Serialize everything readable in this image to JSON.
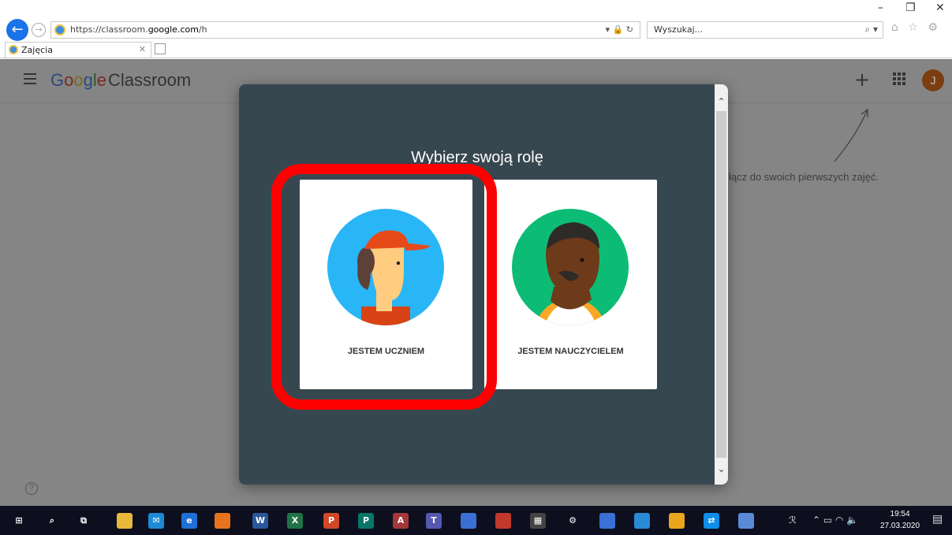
{
  "window": {
    "minimize": "–",
    "restore": "❐",
    "close": "✕"
  },
  "browser": {
    "url_prefix": "https://classroom.",
    "url_domain": "google.com",
    "url_suffix": "/h",
    "url_tools": "▾ 🔒 ↻",
    "search_placeholder": "Wyszukaj...",
    "search_glyph": "⌕ ▾",
    "fav_glyphs": "⌂ ☆ ⚙",
    "tab_title": "Zajęcia",
    "tab_close": "✕"
  },
  "page": {
    "logo_google": [
      "G",
      "o",
      "o",
      "g",
      "l",
      "e"
    ],
    "logo_classroom": "Classroom",
    "plus": "+",
    "avatar_letter": "J",
    "hint_text": "łącz do swoich pierwszych zajęć.",
    "help": "?"
  },
  "dialog": {
    "title": "Wybierz swoją rolę",
    "roles": [
      {
        "label": "JESTEM UCZNIEM"
      },
      {
        "label": "JESTEM NAUCZYCIELEM"
      }
    ],
    "scroll_up": "⌃",
    "scroll_down": "⌄"
  },
  "taskbar": {
    "items": [
      {
        "name": "windows-start-icon",
        "glyph": "⊞",
        "color": "#0d0f1e"
      },
      {
        "name": "search-icon",
        "glyph": "⌕",
        "color": "#0d0f1e"
      },
      {
        "name": "task-view-icon",
        "glyph": "⧉",
        "color": "#0d0f1e"
      },
      {
        "name": "file-explorer-icon",
        "glyph": "",
        "color": "#e8b83a"
      },
      {
        "name": "mail-icon",
        "glyph": "✉",
        "color": "#1e8ad6"
      },
      {
        "name": "internet-explorer-icon",
        "glyph": "e",
        "color": "#1e6fd6"
      },
      {
        "name": "firefox-icon",
        "glyph": "",
        "color": "#e8731e"
      },
      {
        "name": "word-icon",
        "glyph": "W",
        "color": "#2b579a"
      },
      {
        "name": "excel-icon",
        "glyph": "X",
        "color": "#217346"
      },
      {
        "name": "powerpoint-icon",
        "glyph": "P",
        "color": "#d24726"
      },
      {
        "name": "publisher-icon",
        "glyph": "P",
        "color": "#077568"
      },
      {
        "name": "access-icon",
        "glyph": "A",
        "color": "#a4373a"
      },
      {
        "name": "teams-icon",
        "glyph": "T",
        "color": "#5558af"
      },
      {
        "name": "save-disk-icon",
        "glyph": "",
        "color": "#3a6fd6"
      },
      {
        "name": "app-icon",
        "glyph": "",
        "color": "#c0392b"
      },
      {
        "name": "calculator-icon",
        "glyph": "▦",
        "color": "#444"
      },
      {
        "name": "settings-icon",
        "glyph": "⚙",
        "color": "#0d0f1e"
      },
      {
        "name": "network-app-icon",
        "glyph": "",
        "color": "#3a6fd6"
      },
      {
        "name": "app2-icon",
        "glyph": "",
        "color": "#2a8ad6"
      },
      {
        "name": "chrome-icon",
        "glyph": "",
        "color": "#e8a51e"
      },
      {
        "name": "teamviewer-icon",
        "glyph": "⇄",
        "color": "#0e8ee9"
      },
      {
        "name": "app3-icon",
        "glyph": "",
        "color": "#5a8ad6"
      }
    ],
    "tray_people": "ℛ",
    "tray_icons": "⌃  ▭  ◠  🔈",
    "time": "19:54",
    "date": "27.03.2020",
    "notify": "▤"
  },
  "colors": {
    "highlight": "#ff0000",
    "dialog_bg": "#37474f",
    "overlay": "#858585"
  }
}
